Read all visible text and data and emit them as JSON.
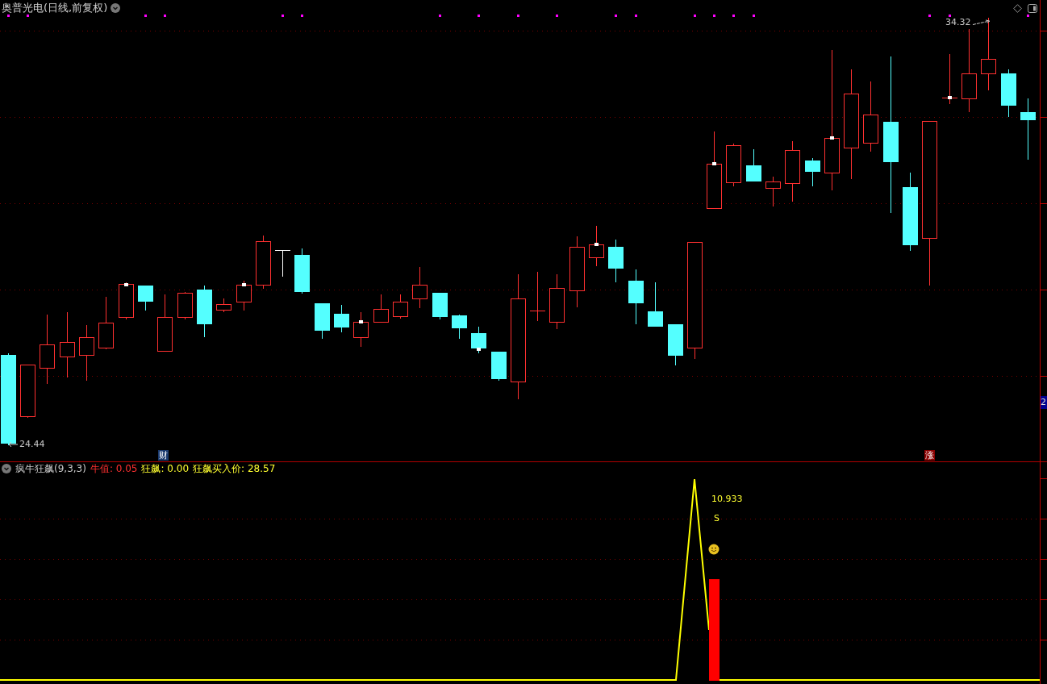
{
  "chart_header": {
    "title": "奥普光电(日线,前复权)"
  },
  "price_labels": [
    {
      "kind": "high",
      "text": "34.32"
    },
    {
      "kind": "low",
      "text": "24.44"
    }
  ],
  "event_badges": [
    {
      "text": "财",
      "color": "#1a3a6e"
    },
    {
      "text": "涨",
      "color": "#8b0000"
    }
  ],
  "axis_label": {
    "text": "2"
  },
  "indicator": {
    "name": "疯牛狂飙(9,3,3)",
    "values": [
      {
        "label": "牛值:",
        "value": "0.05",
        "color": "#ff3030"
      },
      {
        "label": "狂飙:",
        "value": "0.00",
        "color": "#ffff30"
      },
      {
        "label": "狂飙买入价:",
        "value": "28.57",
        "color": "#ffff30"
      }
    ],
    "annotations": [
      {
        "kind": "value",
        "text": "10.933"
      },
      {
        "kind": "signal",
        "text": "S"
      }
    ]
  }
}
